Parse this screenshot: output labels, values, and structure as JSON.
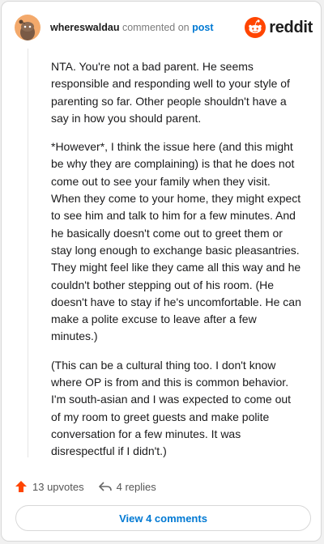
{
  "header": {
    "username": "whereswaldau",
    "action_text": "commented on",
    "post_link": "post",
    "brand": "reddit"
  },
  "comment": {
    "paragraphs": [
      "NTA. You're not a bad parent. He seems responsible and responding well to your style of parenting so far. Other people shouldn't have a say in how you should parent.",
      "*However*, I think the issue here (and this might be why they are complaining) is that he does not come out to see your family when they visit. When they come to your home, they might expect to see him and talk to him for a few minutes. And he basically doesn't come out to greet them or stay long enough to exchange basic pleasantries. They might feel like they came all this way and he couldn't bother stepping out of his room. (He doesn't have to stay if he's uncomfortable. He can make a polite excuse to leave after a few minutes.)",
      "(This can be a cultural thing too. I don't know where OP is from and this is common behavior. I'm south-asian and I was expected to come out of my room to greet guests and make polite conversation for a few minutes. It was disrespectful if I didn't.)"
    ]
  },
  "footer": {
    "upvotes": "13 upvotes",
    "replies": "4 replies"
  },
  "view_button": "View 4 comments",
  "colors": {
    "brand_orange": "#ff4500",
    "link_blue": "#0079d3",
    "avatar_bg": "#f3a96b"
  },
  "icons": {
    "avatar": "snoo-avatar",
    "brand": "reddit-logo-icon",
    "upvote": "upvote-arrow-icon",
    "reply": "reply-arrow-icon"
  }
}
